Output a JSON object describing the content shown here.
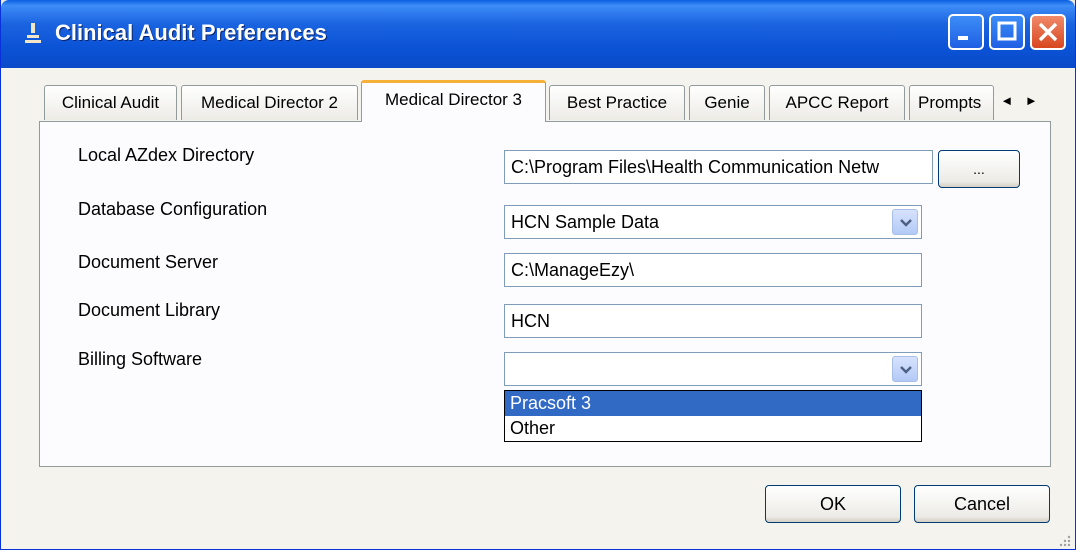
{
  "window": {
    "title": "Clinical Audit Preferences",
    "minimize_label": "minimize",
    "maximize_label": "maximize",
    "close_label": "close"
  },
  "tabs": [
    {
      "label": "Clinical Audit",
      "active": false
    },
    {
      "label": "Medical Director 2",
      "active": false
    },
    {
      "label": "Medical Director 3",
      "active": true
    },
    {
      "label": "Best Practice",
      "active": false
    },
    {
      "label": "Genie",
      "active": false
    },
    {
      "label": "APCC Report",
      "active": false
    },
    {
      "label": "Prompts",
      "active": false
    }
  ],
  "tab_scroll": {
    "left": "◄",
    "right": "►"
  },
  "form": {
    "azdex": {
      "label": "Local AZdex Directory",
      "value": "C:\\Program Files\\Health Communication Netw",
      "browse_label": "..."
    },
    "db_config": {
      "label": "Database Configuration",
      "value": "HCN Sample Data"
    },
    "doc_server": {
      "label": "Document Server",
      "value": "C:\\ManageEzy\\"
    },
    "doc_library": {
      "label": "Document Library",
      "value": "HCN"
    },
    "billing": {
      "label": "Billing Software",
      "value": "",
      "options": [
        "Pracsoft 3",
        "Other"
      ],
      "highlighted": "Pracsoft 3"
    }
  },
  "buttons": {
    "ok": "OK",
    "cancel": "Cancel"
  },
  "colors": {
    "titlebar": "#0a53d6",
    "selection": "#316ac5",
    "active_tab_accent": "#f6b03a"
  }
}
